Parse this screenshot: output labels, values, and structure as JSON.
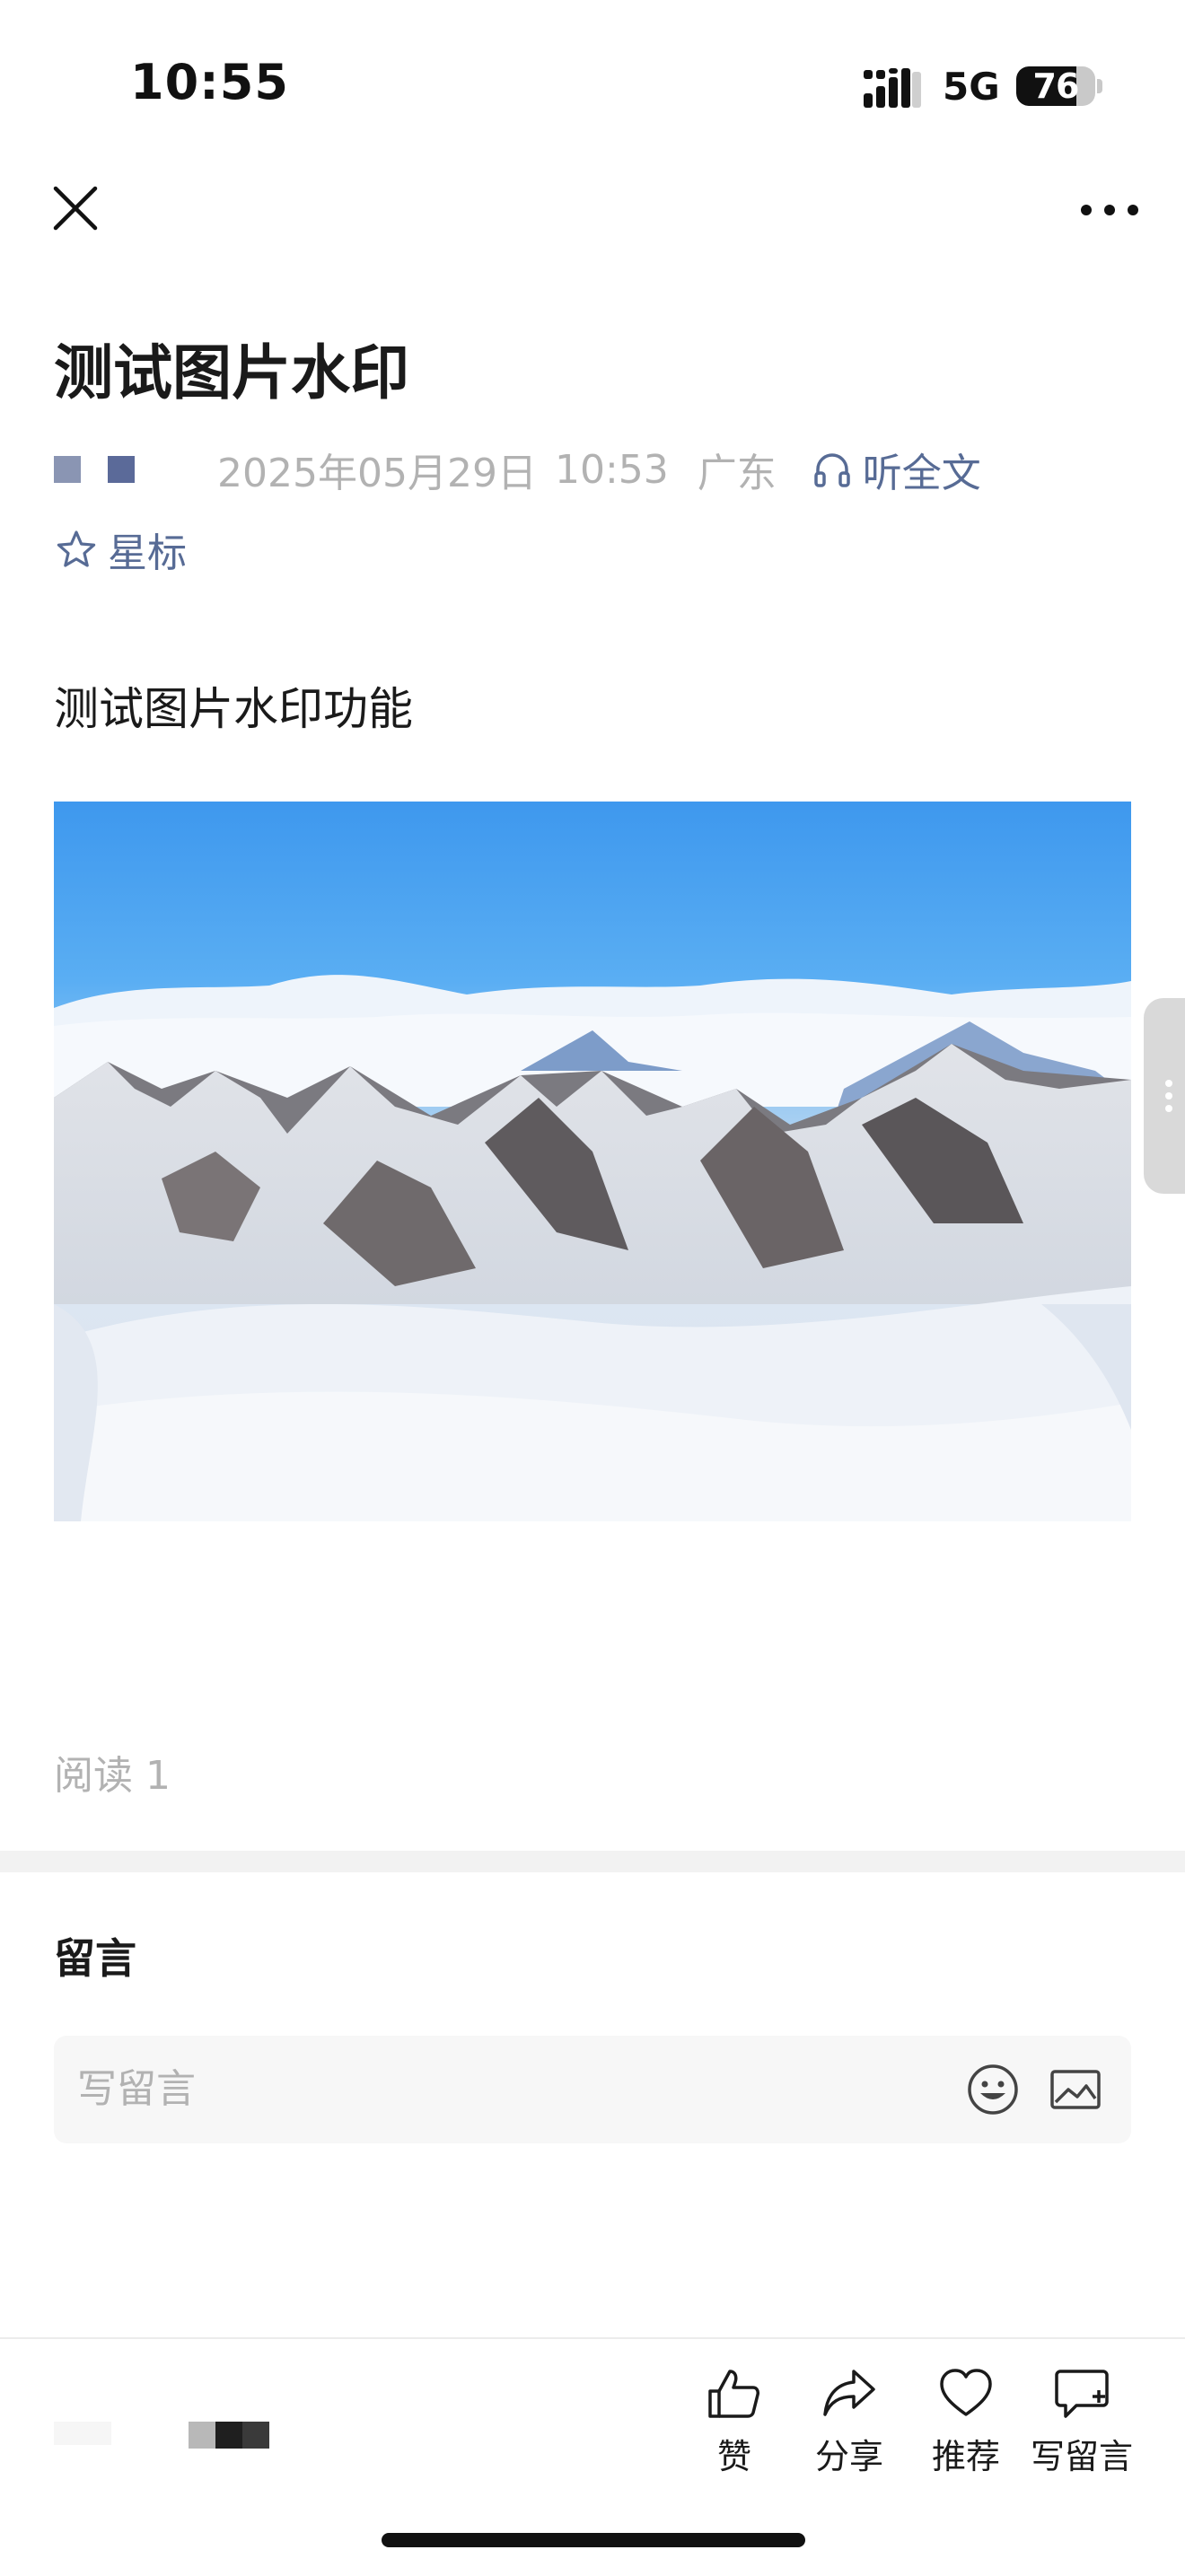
{
  "status_bar": {
    "time": "10:55",
    "network": "5G",
    "battery_level": "76"
  },
  "article": {
    "title": "测试图片水印",
    "date": "2025年05月29日",
    "time": "10:53",
    "region": "广东",
    "listen_label": "听全文",
    "star_label": "星标",
    "body_text": "测试图片水印功能",
    "read_count": "阅读 1"
  },
  "comments": {
    "title": "留言",
    "placeholder": "写留言"
  },
  "bottom_bar": {
    "like_label": "赞",
    "share_label": "分享",
    "recommend_label": "推荐",
    "write_comment_label": "写留言"
  },
  "colors": {
    "link": "#576b95",
    "muted_text": "#b2b2b2",
    "sky": "#4aa6f2"
  },
  "icons": [
    "close-icon",
    "more-icon",
    "headphone-icon",
    "star-icon",
    "emoji-icon",
    "image-icon",
    "thumbs-up-icon",
    "share-icon",
    "heart-icon",
    "add-comment-icon"
  ]
}
